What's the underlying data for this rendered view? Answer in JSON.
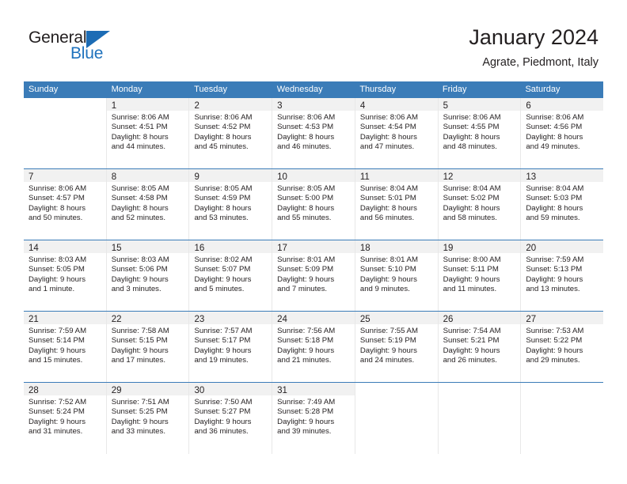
{
  "logo": {
    "word_general": "General",
    "word_blue": "Blue",
    "triangle_color": "#1c6cb5",
    "blue_color": "#1f72bd"
  },
  "header": {
    "month_title": "January 2024",
    "location": "Agrate, Piedmont, Italy"
  },
  "calendar": {
    "header_bg": "#3b7cb8",
    "daynum_band_bg": "#f1f1f1",
    "weekdays": [
      "Sunday",
      "Monday",
      "Tuesday",
      "Wednesday",
      "Thursday",
      "Friday",
      "Saturday"
    ],
    "weeks": [
      [
        {
          "day": "",
          "sunrise": "",
          "sunset": "",
          "daylight_line1": "",
          "daylight_line2": ""
        },
        {
          "day": "1",
          "sunrise": "Sunrise: 8:06 AM",
          "sunset": "Sunset: 4:51 PM",
          "daylight_line1": "Daylight: 8 hours",
          "daylight_line2": "and 44 minutes."
        },
        {
          "day": "2",
          "sunrise": "Sunrise: 8:06 AM",
          "sunset": "Sunset: 4:52 PM",
          "daylight_line1": "Daylight: 8 hours",
          "daylight_line2": "and 45 minutes."
        },
        {
          "day": "3",
          "sunrise": "Sunrise: 8:06 AM",
          "sunset": "Sunset: 4:53 PM",
          "daylight_line1": "Daylight: 8 hours",
          "daylight_line2": "and 46 minutes."
        },
        {
          "day": "4",
          "sunrise": "Sunrise: 8:06 AM",
          "sunset": "Sunset: 4:54 PM",
          "daylight_line1": "Daylight: 8 hours",
          "daylight_line2": "and 47 minutes."
        },
        {
          "day": "5",
          "sunrise": "Sunrise: 8:06 AM",
          "sunset": "Sunset: 4:55 PM",
          "daylight_line1": "Daylight: 8 hours",
          "daylight_line2": "and 48 minutes."
        },
        {
          "day": "6",
          "sunrise": "Sunrise: 8:06 AM",
          "sunset": "Sunset: 4:56 PM",
          "daylight_line1": "Daylight: 8 hours",
          "daylight_line2": "and 49 minutes."
        }
      ],
      [
        {
          "day": "7",
          "sunrise": "Sunrise: 8:06 AM",
          "sunset": "Sunset: 4:57 PM",
          "daylight_line1": "Daylight: 8 hours",
          "daylight_line2": "and 50 minutes."
        },
        {
          "day": "8",
          "sunrise": "Sunrise: 8:05 AM",
          "sunset": "Sunset: 4:58 PM",
          "daylight_line1": "Daylight: 8 hours",
          "daylight_line2": "and 52 minutes."
        },
        {
          "day": "9",
          "sunrise": "Sunrise: 8:05 AM",
          "sunset": "Sunset: 4:59 PM",
          "daylight_line1": "Daylight: 8 hours",
          "daylight_line2": "and 53 minutes."
        },
        {
          "day": "10",
          "sunrise": "Sunrise: 8:05 AM",
          "sunset": "Sunset: 5:00 PM",
          "daylight_line1": "Daylight: 8 hours",
          "daylight_line2": "and 55 minutes."
        },
        {
          "day": "11",
          "sunrise": "Sunrise: 8:04 AM",
          "sunset": "Sunset: 5:01 PM",
          "daylight_line1": "Daylight: 8 hours",
          "daylight_line2": "and 56 minutes."
        },
        {
          "day": "12",
          "sunrise": "Sunrise: 8:04 AM",
          "sunset": "Sunset: 5:02 PM",
          "daylight_line1": "Daylight: 8 hours",
          "daylight_line2": "and 58 minutes."
        },
        {
          "day": "13",
          "sunrise": "Sunrise: 8:04 AM",
          "sunset": "Sunset: 5:03 PM",
          "daylight_line1": "Daylight: 8 hours",
          "daylight_line2": "and 59 minutes."
        }
      ],
      [
        {
          "day": "14",
          "sunrise": "Sunrise: 8:03 AM",
          "sunset": "Sunset: 5:05 PM",
          "daylight_line1": "Daylight: 9 hours",
          "daylight_line2": "and 1 minute."
        },
        {
          "day": "15",
          "sunrise": "Sunrise: 8:03 AM",
          "sunset": "Sunset: 5:06 PM",
          "daylight_line1": "Daylight: 9 hours",
          "daylight_line2": "and 3 minutes."
        },
        {
          "day": "16",
          "sunrise": "Sunrise: 8:02 AM",
          "sunset": "Sunset: 5:07 PM",
          "daylight_line1": "Daylight: 9 hours",
          "daylight_line2": "and 5 minutes."
        },
        {
          "day": "17",
          "sunrise": "Sunrise: 8:01 AM",
          "sunset": "Sunset: 5:09 PM",
          "daylight_line1": "Daylight: 9 hours",
          "daylight_line2": "and 7 minutes."
        },
        {
          "day": "18",
          "sunrise": "Sunrise: 8:01 AM",
          "sunset": "Sunset: 5:10 PM",
          "daylight_line1": "Daylight: 9 hours",
          "daylight_line2": "and 9 minutes."
        },
        {
          "day": "19",
          "sunrise": "Sunrise: 8:00 AM",
          "sunset": "Sunset: 5:11 PM",
          "daylight_line1": "Daylight: 9 hours",
          "daylight_line2": "and 11 minutes."
        },
        {
          "day": "20",
          "sunrise": "Sunrise: 7:59 AM",
          "sunset": "Sunset: 5:13 PM",
          "daylight_line1": "Daylight: 9 hours",
          "daylight_line2": "and 13 minutes."
        }
      ],
      [
        {
          "day": "21",
          "sunrise": "Sunrise: 7:59 AM",
          "sunset": "Sunset: 5:14 PM",
          "daylight_line1": "Daylight: 9 hours",
          "daylight_line2": "and 15 minutes."
        },
        {
          "day": "22",
          "sunrise": "Sunrise: 7:58 AM",
          "sunset": "Sunset: 5:15 PM",
          "daylight_line1": "Daylight: 9 hours",
          "daylight_line2": "and 17 minutes."
        },
        {
          "day": "23",
          "sunrise": "Sunrise: 7:57 AM",
          "sunset": "Sunset: 5:17 PM",
          "daylight_line1": "Daylight: 9 hours",
          "daylight_line2": "and 19 minutes."
        },
        {
          "day": "24",
          "sunrise": "Sunrise: 7:56 AM",
          "sunset": "Sunset: 5:18 PM",
          "daylight_line1": "Daylight: 9 hours",
          "daylight_line2": "and 21 minutes."
        },
        {
          "day": "25",
          "sunrise": "Sunrise: 7:55 AM",
          "sunset": "Sunset: 5:19 PM",
          "daylight_line1": "Daylight: 9 hours",
          "daylight_line2": "and 24 minutes."
        },
        {
          "day": "26",
          "sunrise": "Sunrise: 7:54 AM",
          "sunset": "Sunset: 5:21 PM",
          "daylight_line1": "Daylight: 9 hours",
          "daylight_line2": "and 26 minutes."
        },
        {
          "day": "27",
          "sunrise": "Sunrise: 7:53 AM",
          "sunset": "Sunset: 5:22 PM",
          "daylight_line1": "Daylight: 9 hours",
          "daylight_line2": "and 29 minutes."
        }
      ],
      [
        {
          "day": "28",
          "sunrise": "Sunrise: 7:52 AM",
          "sunset": "Sunset: 5:24 PM",
          "daylight_line1": "Daylight: 9 hours",
          "daylight_line2": "and 31 minutes."
        },
        {
          "day": "29",
          "sunrise": "Sunrise: 7:51 AM",
          "sunset": "Sunset: 5:25 PM",
          "daylight_line1": "Daylight: 9 hours",
          "daylight_line2": "and 33 minutes."
        },
        {
          "day": "30",
          "sunrise": "Sunrise: 7:50 AM",
          "sunset": "Sunset: 5:27 PM",
          "daylight_line1": "Daylight: 9 hours",
          "daylight_line2": "and 36 minutes."
        },
        {
          "day": "31",
          "sunrise": "Sunrise: 7:49 AM",
          "sunset": "Sunset: 5:28 PM",
          "daylight_line1": "Daylight: 9 hours",
          "daylight_line2": "and 39 minutes."
        },
        {
          "day": "",
          "sunrise": "",
          "sunset": "",
          "daylight_line1": "",
          "daylight_line2": ""
        },
        {
          "day": "",
          "sunrise": "",
          "sunset": "",
          "daylight_line1": "",
          "daylight_line2": ""
        },
        {
          "day": "",
          "sunrise": "",
          "sunset": "",
          "daylight_line1": "",
          "daylight_line2": ""
        }
      ]
    ]
  }
}
